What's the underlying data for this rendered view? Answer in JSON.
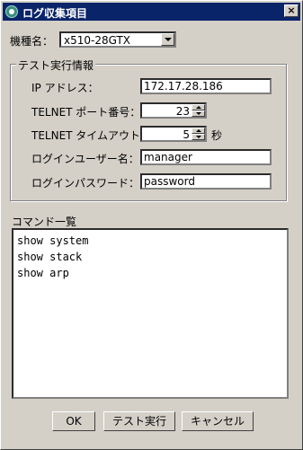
{
  "window": {
    "title": "ログ収集項目",
    "close_label": "×"
  },
  "model": {
    "label": "機種名：",
    "value": "x510-28GTX"
  },
  "test_info": {
    "legend": "テスト実行情報",
    "ip_label": "IP アドレス：",
    "ip_value": "172.17.28.186",
    "telnet_port_label": "TELNET ポート番号：",
    "telnet_port_value": "23",
    "timeout_label": "TELNET タイムアウト値：",
    "timeout_value": "5",
    "timeout_unit": "秒",
    "login_user_label": "ログインユーザー名：",
    "login_user_value": "manager",
    "login_password_label": "ログインパスワード：",
    "login_password_value": "password"
  },
  "commands": {
    "label": "コマンド一覧",
    "lines": [
      "show system",
      "show stack",
      "show arp"
    ]
  },
  "buttons": {
    "ok": "OK",
    "test_run": "テスト実行",
    "cancel": "キャンセル"
  }
}
